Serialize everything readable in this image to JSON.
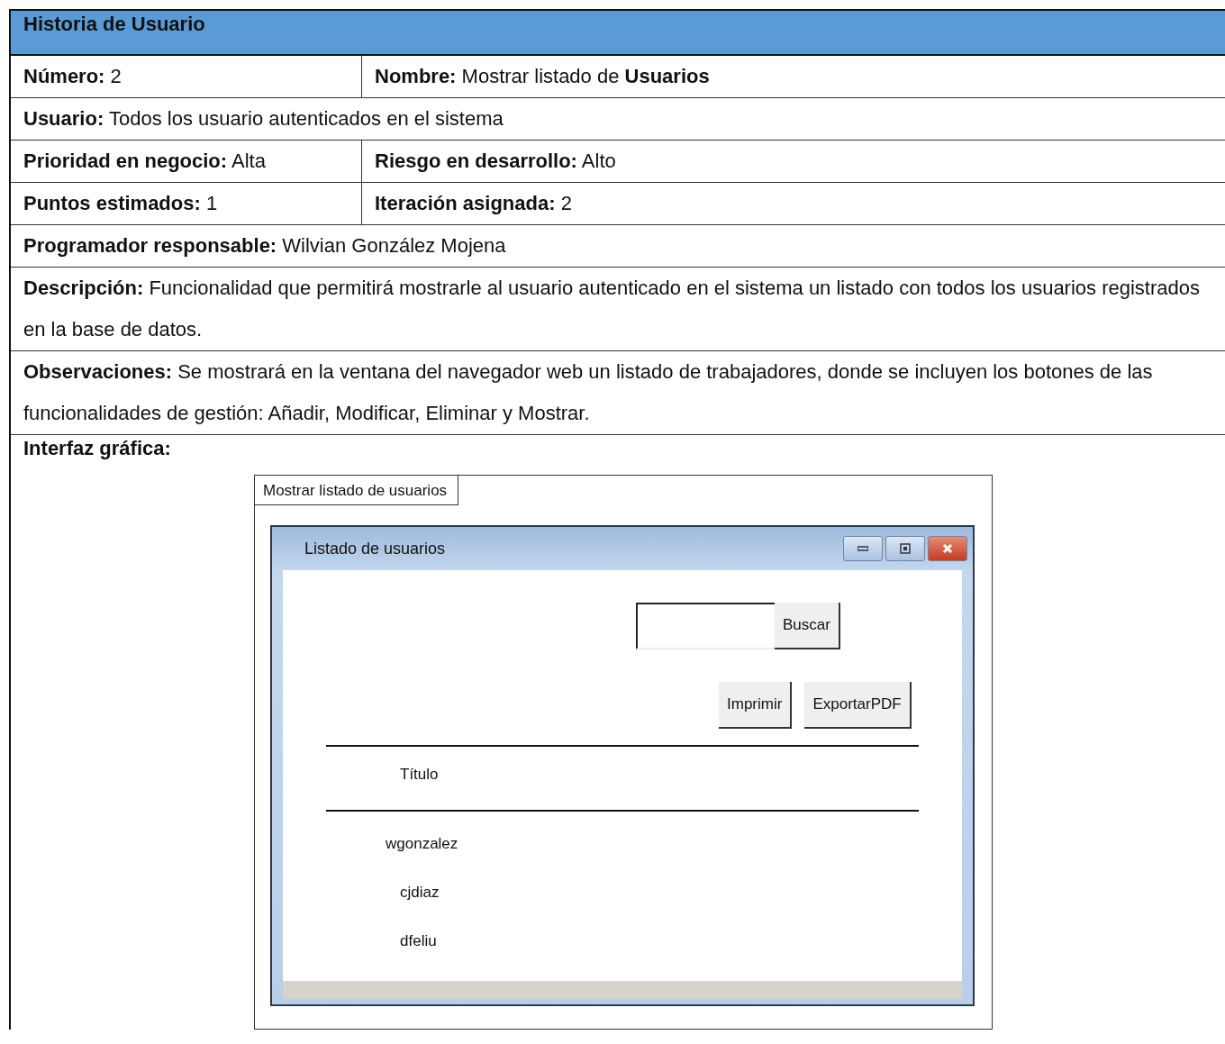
{
  "table": {
    "header": "Historia de Usuario",
    "rows": [
      {
        "cells": [
          "**Número:** 2",
          "**Nombre:** Mostrar listado de **Usuarios**"
        ]
      },
      {
        "cells": [
          "**Usuario:** Todos los usuario autenticados en el sistema"
        ]
      },
      {
        "cells": [
          "**Prioridad en negocio:** Alta",
          "**Riesgo en desarrollo:** Alto"
        ]
      },
      {
        "cells": [
          "**Puntos estimados:** 1",
          "**Iteración asignada:** 2"
        ]
      },
      {
        "cells": [
          "**Programador responsable:** Wilvian González Mojena"
        ]
      },
      {
        "cells": [
          "**Descripción:** Funcionalidad que permitirá mostrarle al usuario autenticado en el sistema un listado con todos los usuarios registrados en la base de datos."
        ]
      },
      {
        "cells": [
          "**Observaciones:** Se mostrará en la ventana del navegador web un listado de trabajadores, donde se incluyen los botones de las funcionalidades de gestión: Añadir, Modificar, Eliminar y Mostrar."
        ]
      }
    ],
    "interface_label": "Interfaz gráfica:"
  },
  "mockup": {
    "tab_label": "Mostrar listado de usuarios",
    "window": {
      "title": "Listado de usuarios"
    },
    "search_button": "Buscar",
    "action_buttons": [
      "Imprimir",
      "ExportarPDF"
    ],
    "column_heading": "Título",
    "items": [
      "wgonzalez",
      "cjdiaz",
      "dfeliu"
    ]
  }
}
